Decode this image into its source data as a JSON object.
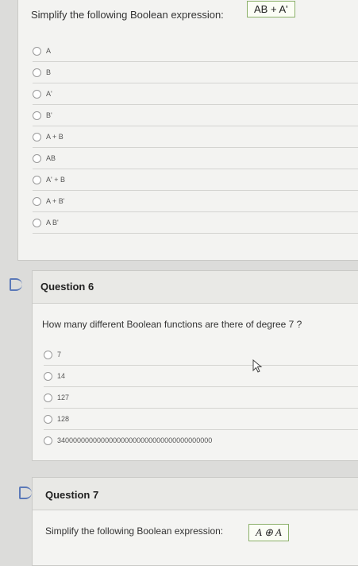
{
  "top_question": {
    "prompt": "Simplify the following Boolean expression:",
    "expression": "AB + A'",
    "options": [
      "A",
      "B",
      "A'",
      "B'",
      "A + B",
      "AB",
      "A' + B",
      "A + B'",
      "A B'"
    ]
  },
  "question6": {
    "title": "Question 6",
    "prompt": "How many different Boolean functions are there of degree 7 ?",
    "options": [
      "7",
      "14",
      "127",
      "128",
      "340000000000000000000000000000000000000"
    ]
  },
  "question7": {
    "title": "Question 7",
    "prompt": "Simplify the following Boolean expression:",
    "expression": "A ⊕ A"
  },
  "icons": {
    "flag": "flag-icon",
    "radio": "radio-button",
    "cursor": "pointer-cursor-icon"
  },
  "colors": {
    "flag": "#5b79b8",
    "answer_border": "#8bb06a"
  }
}
